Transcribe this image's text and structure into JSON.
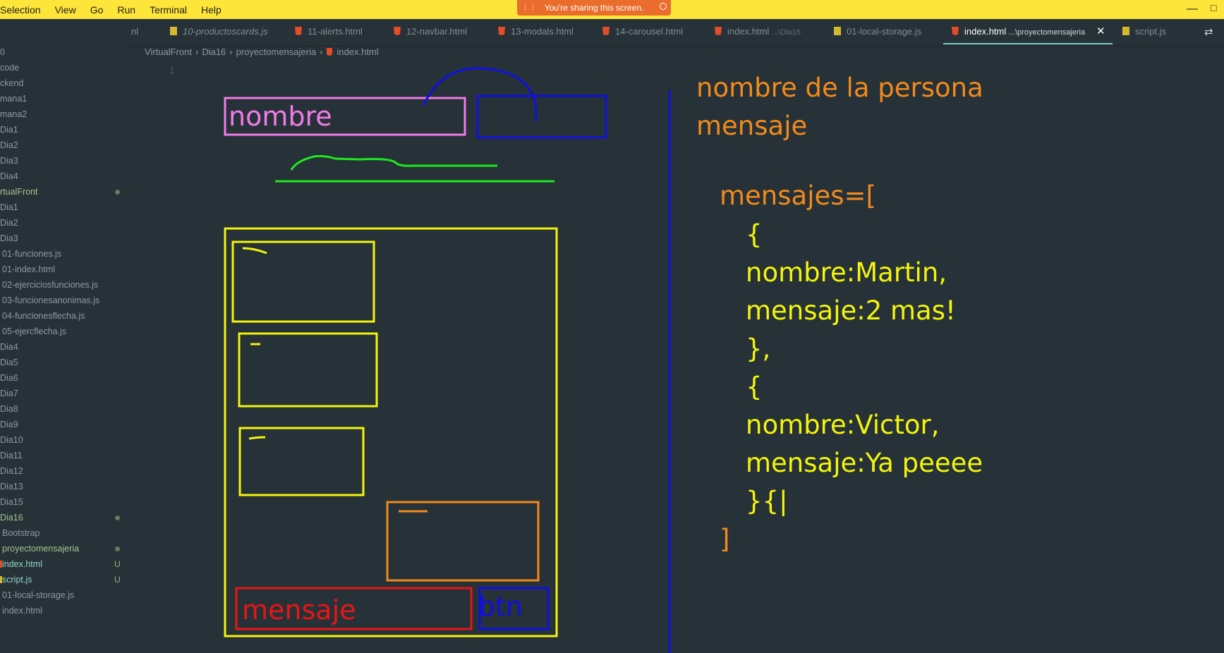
{
  "menubar": {
    "items": [
      "Selection",
      "View",
      "Go",
      "Run",
      "Terminal",
      "Help"
    ],
    "share_banner": "You're sharing this screen.",
    "minimize_glyph": "—",
    "maximize_glyph": "□"
  },
  "sidebar": {
    "items": [
      {
        "label": "0"
      },
      {
        "label": "code"
      },
      {
        "label": "ckend"
      },
      {
        "label": "mana1"
      },
      {
        "label": "mana2"
      },
      {
        "label": "Dia1"
      },
      {
        "label": "Dia2"
      },
      {
        "label": "Dia3"
      },
      {
        "label": "Dia4"
      },
      {
        "label": "rtualFront",
        "status": "modified"
      },
      {
        "label": "Dia1"
      },
      {
        "label": "Dia2"
      },
      {
        "label": "Dia3"
      },
      {
        "label": "01-funciones.js"
      },
      {
        "label": "01-index.html"
      },
      {
        "label": "02-ejerciciosfunciones.js"
      },
      {
        "label": "03-funcionesanonimas.js"
      },
      {
        "label": "04-funcionesflecha.js"
      },
      {
        "label": "05-ejercflecha.js"
      },
      {
        "label": "Dia4"
      },
      {
        "label": "Dia5"
      },
      {
        "label": "Dia6"
      },
      {
        "label": "Dia7"
      },
      {
        "label": "Dia8"
      },
      {
        "label": "Dia9"
      },
      {
        "label": "Dia10"
      },
      {
        "label": "Dia11"
      },
      {
        "label": "Dia12"
      },
      {
        "label": "Dia13"
      },
      {
        "label": "Dia15"
      },
      {
        "label": "Dia16",
        "status": "modified"
      },
      {
        "label": "Bootstrap"
      },
      {
        "label": "proyectomensajeria",
        "status": "modified"
      },
      {
        "label": "index.html",
        "badge": "U"
      },
      {
        "label": "script.js",
        "badge": "U"
      },
      {
        "label": "01-local-storage.js"
      },
      {
        "label": "index.html"
      }
    ]
  },
  "tabs": {
    "items": [
      {
        "label": "nl"
      },
      {
        "label": "10-productoscards.js",
        "icon": "js-file-icon"
      },
      {
        "label": "11-alerts.html",
        "icon": "html-file-icon"
      },
      {
        "label": "12-navbar.html",
        "icon": "html-file-icon"
      },
      {
        "label": "13-modals.html",
        "icon": "html-file-icon"
      },
      {
        "label": "14-carousel.html",
        "icon": "html-file-icon"
      },
      {
        "label": "index.html",
        "hint": "...\\Dia16",
        "icon": "html-file-icon"
      },
      {
        "label": "01-local-storage.js",
        "icon": "js-file-icon"
      },
      {
        "label": "index.html",
        "hint": "...\\proyectomensajeria",
        "icon": "html-file-icon",
        "active": true
      },
      {
        "label": "script.js",
        "icon": "js-file-icon"
      }
    ],
    "close_glyph": "✕",
    "layout_glyph": "⇄"
  },
  "breadcrumb": {
    "parts": [
      "VirtualFront",
      "Dia16",
      "proyectomensajeria",
      "index.html"
    ],
    "separator": "›"
  },
  "editor": {
    "line_number": "1"
  },
  "sketch": {
    "nombre_label": "nombre",
    "mensaje_label": "mensaje",
    "btn_label": "btn",
    "notes": {
      "line1": "nombre de la persona",
      "line2": "mensaje",
      "line3": "mensajes=[",
      "line4": "{",
      "line5": "nombre:Martin,",
      "line6": "mensaje:2 mas!",
      "line7": "},",
      "line8": "{",
      "line9": "nombre:Victor,",
      "line10": "mensaje:Ya peeee",
      "line11": "}{|",
      "line12": "]"
    }
  },
  "colors": {
    "menubar": "#fde53a",
    "editor_bg": "#263238",
    "share_banner": "#ea6d2e",
    "ink_orange": "#f28a1b",
    "ink_yellow": "#f4f40b",
    "ink_blue": "#1010e0",
    "ink_pink": "#f07be8",
    "ink_red": "#e81515",
    "ink_green": "#1ee81e"
  }
}
